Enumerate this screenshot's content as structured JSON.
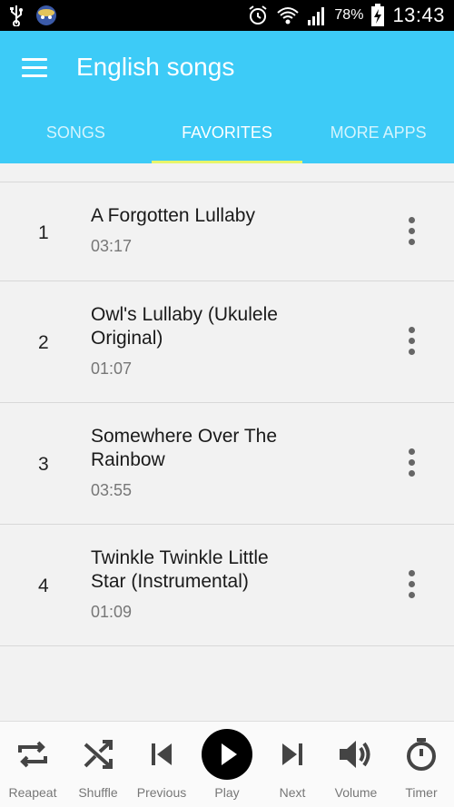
{
  "status_bar": {
    "battery_pct": "78%",
    "time": "13:43"
  },
  "app_bar": {
    "title": "English songs",
    "menu_icon": "hamburger-menu-icon"
  },
  "tabs": [
    {
      "label": "SONGS",
      "active": false
    },
    {
      "label": "FAVORITES",
      "active": true
    },
    {
      "label": "MORE APPS",
      "active": false
    }
  ],
  "songs": [
    {
      "num": "1",
      "title": "A Forgotten Lullaby",
      "duration": "03:17"
    },
    {
      "num": "2",
      "title": "Owl's Lullaby (Ukulele Original)",
      "duration": "01:07"
    },
    {
      "num": "3",
      "title": "Somewhere Over The Rainbow",
      "duration": "03:55"
    },
    {
      "num": "4",
      "title": "Twinkle Twinkle Little Star (Instrumental)",
      "duration": "01:09"
    }
  ],
  "player": {
    "repeat": "Reapeat",
    "shuffle": "Shuffle",
    "previous": "Previous",
    "play": "Play",
    "next": "Next",
    "volume": "Volume",
    "timer": "Timer"
  },
  "colors": {
    "app_bar": "#3dcbf7",
    "tab_indicator": "#e8f56a"
  }
}
